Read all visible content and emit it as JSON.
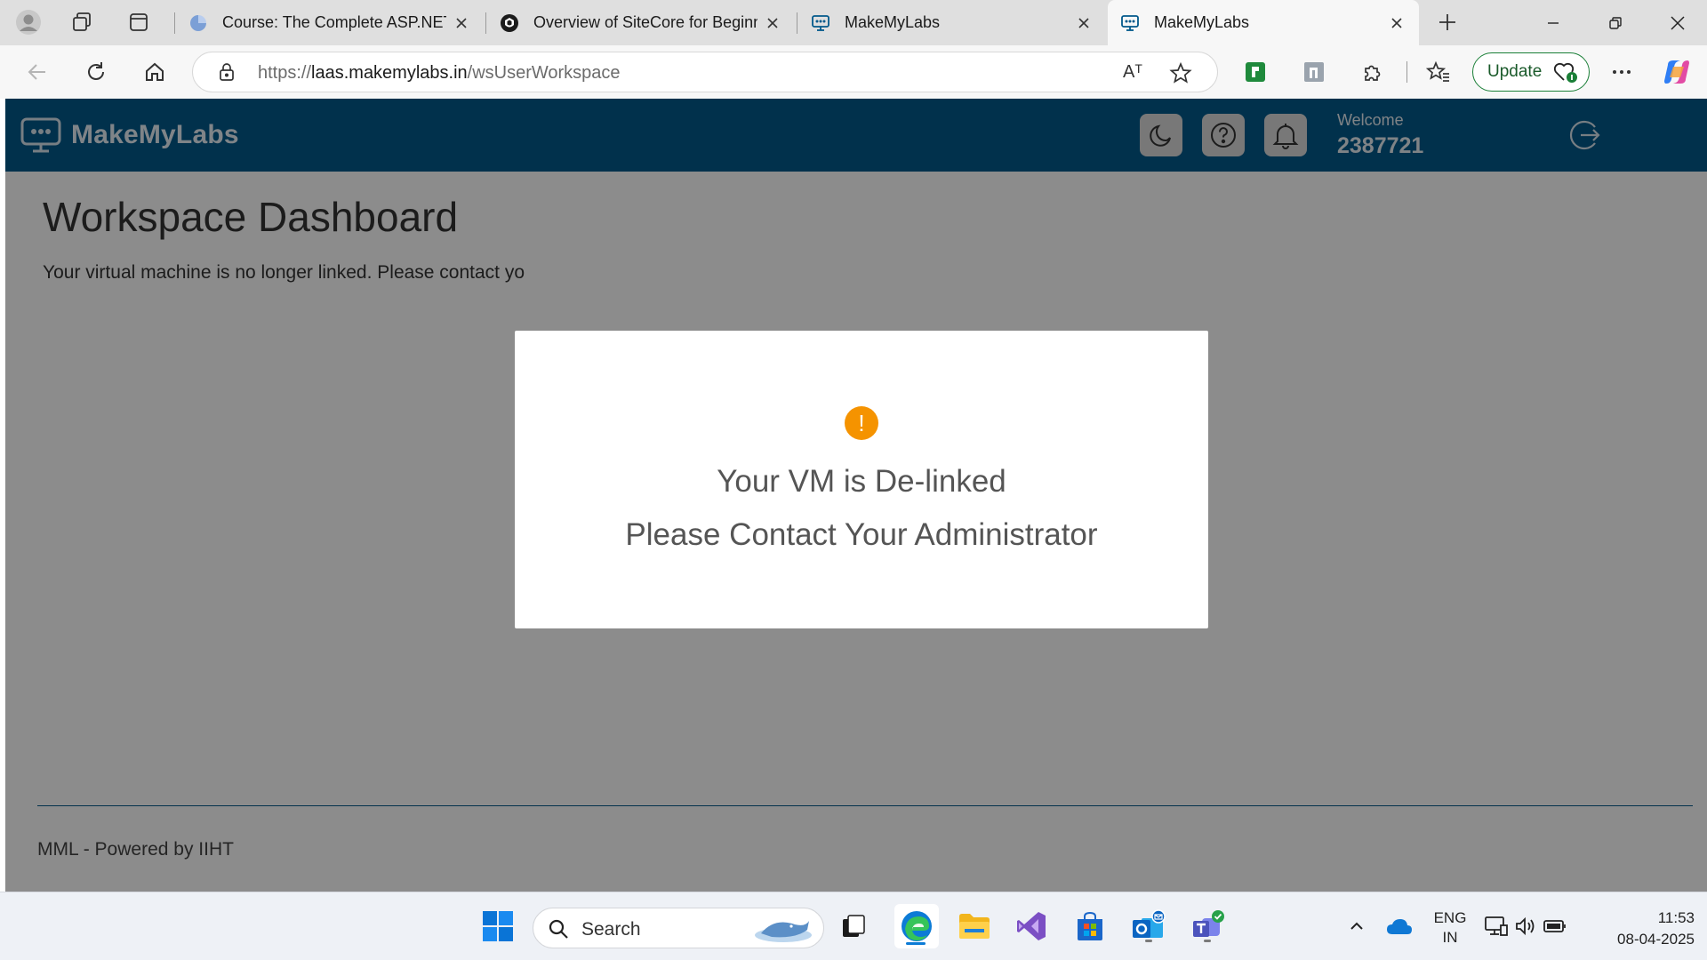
{
  "browser": {
    "tabs": [
      {
        "label": "Course: The Complete ASP.NET M",
        "icon": "course-favicon",
        "active": false
      },
      {
        "label": "Overview of SiteCore for Beginne",
        "icon": "udemy-favicon",
        "active": false
      },
      {
        "label": "MakeMyLabs",
        "icon": "makemylabs-favicon",
        "active": false
      },
      {
        "label": "MakeMyLabs",
        "icon": "makemylabs-favicon",
        "active": true
      }
    ],
    "address": {
      "prefix": "https://",
      "host": "laas.makemylabs.in",
      "path": "/wsUserWorkspace"
    },
    "read_aloud_label": "Aᵀ",
    "update_label": "Update"
  },
  "app": {
    "logo_text": "MakeMyLabs",
    "welcome_label": "Welcome",
    "user_id": "2387721",
    "brand_color": "#02598b"
  },
  "page": {
    "title": "Workspace Dashboard",
    "message": "Your virtual machine is no longer linked. Please contact yo",
    "footer": "MML - Powered by IIHT"
  },
  "modal": {
    "icon_glyph": "!",
    "line1": "Your VM is De-linked",
    "line2": "Please Contact Your Administrator",
    "icon_color": "#f59300"
  },
  "taskbar": {
    "search_label": "Search",
    "lang_line1": "ENG",
    "lang_line2": "IN",
    "time": "11:53",
    "date": "08-04-2025"
  }
}
